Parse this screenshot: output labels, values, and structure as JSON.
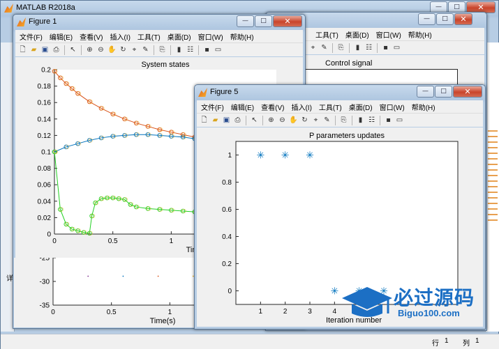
{
  "matlab": {
    "title": "MATLAB R2018a",
    "status_row_label": "行",
    "status_row_value": "1",
    "status_col_label": "列",
    "status_col_value": "1",
    "side_text": "详"
  },
  "menus": [
    "文件(F)",
    "编辑(E)",
    "查看(V)",
    "插入(I)",
    "工具(T)",
    "桌面(D)",
    "窗口(W)",
    "帮助(H)"
  ],
  "figure_back": {
    "menus_visible": [
      "工具(T)",
      "桌面(D)",
      "窗口(W)",
      "帮助(H)"
    ],
    "plot_title": "Control signal"
  },
  "figure1": {
    "title": "Figure 1",
    "lower_xlabel": "Time(s)"
  },
  "figure5": {
    "title": "Figure 5"
  },
  "watermark": {
    "brand": "必过源码",
    "url": "Biguo100.com"
  },
  "colors": {
    "title_bar": "#c7d9ec",
    "figure_bg": "#f0f0f0",
    "blue": "#0072BD",
    "orange": "#D95319",
    "yellow": "#EDB120",
    "green": "#22d022",
    "watermark_blue": "#1c6fc4"
  },
  "icons": [
    "new-file-icon",
    "open-icon",
    "save-icon",
    "print-icon",
    "pointer-icon",
    "zoom-in-icon",
    "zoom-out-icon",
    "pan-icon",
    "rotate-icon",
    "data-cursor-icon",
    "brush-icon",
    "link-icon",
    "colorbar-icon",
    "legend-icon",
    "grid-icon",
    "property-icon"
  ],
  "chart_data": [
    {
      "id": "system-states",
      "type": "line",
      "title": "System states",
      "xlabel": "Time(s)",
      "ylabel": "",
      "xlim": [
        0,
        1.9
      ],
      "ylim": [
        0,
        0.2
      ],
      "xticks": [
        "0",
        "0.5",
        "1",
        "1.5"
      ],
      "yticks": [
        "0",
        "0.02",
        "0.04",
        "0.06",
        "0.08",
        "0.1",
        "0.12",
        "0.14",
        "0.16",
        "0.18",
        "0.2"
      ],
      "series": [
        {
          "color": "#D95319",
          "x": [
            0,
            0.05,
            0.1,
            0.15,
            0.2,
            0.3,
            0.4,
            0.5,
            0.6,
            0.7,
            0.8,
            0.9,
            1.0,
            1.1,
            1.2,
            1.3,
            1.4,
            1.5,
            1.6,
            1.7,
            1.8,
            1.9
          ],
          "y": [
            0.198,
            0.19,
            0.183,
            0.177,
            0.171,
            0.161,
            0.153,
            0.146,
            0.14,
            0.135,
            0.131,
            0.127,
            0.124,
            0.121,
            0.118,
            0.115,
            0.112,
            0.109,
            0.107,
            0.105,
            0.103,
            0.1
          ]
        },
        {
          "color": "#0072BD",
          "x": [
            0,
            0.1,
            0.2,
            0.3,
            0.4,
            0.5,
            0.6,
            0.7,
            0.8,
            0.9,
            1.0,
            1.1,
            1.2,
            1.3,
            1.4,
            1.5,
            1.6,
            1.7,
            1.8,
            1.9
          ],
          "y": [
            0.1,
            0.106,
            0.11,
            0.114,
            0.117,
            0.119,
            0.12,
            0.121,
            0.121,
            0.12,
            0.119,
            0.118,
            0.116,
            0.114,
            0.112,
            0.11,
            0.107,
            0.105,
            0.103,
            0.101
          ]
        },
        {
          "color": "#22d022",
          "x": [
            0,
            0.05,
            0.1,
            0.15,
            0.2,
            0.25,
            0.3,
            0.32,
            0.35,
            0.4,
            0.45,
            0.5,
            0.55,
            0.6,
            0.65,
            0.7,
            0.8,
            0.9,
            1.0,
            1.1,
            1.2,
            1.3,
            1.4,
            1.5,
            1.6,
            1.7,
            1.8,
            1.9
          ],
          "y": [
            0.1,
            0.03,
            0.012,
            0.006,
            0.004,
            0.002,
            0.001,
            0.022,
            0.038,
            0.043,
            0.044,
            0.044,
            0.043,
            0.042,
            0.036,
            0.033,
            0.031,
            0.03,
            0.029,
            0.028,
            0.027,
            0.026,
            0.025,
            0.024,
            0.024,
            0.023,
            0.023,
            0.022
          ]
        }
      ]
    },
    {
      "id": "p-parameters-updates",
      "type": "scatter",
      "title": "P parameters updates",
      "xlabel": "Iteration number",
      "ylabel": "",
      "xlim": [
        0,
        9
      ],
      "ylim": [
        -0.1,
        1.1
      ],
      "xticks": [
        "1",
        "2",
        "3",
        "4",
        "5"
      ],
      "yticks": [
        "0",
        "0.2",
        "0.4",
        "0.6",
        "0.8",
        "1"
      ],
      "series": [
        {
          "color": "#0072BD",
          "marker": "asterisk",
          "x": [
            1,
            2,
            3,
            4,
            5,
            6
          ],
          "y": [
            1,
            1,
            1,
            0,
            0,
            0
          ]
        }
      ]
    },
    {
      "id": "lower-axes-figure1",
      "type": "scatter",
      "title": "",
      "xlabel": "Time(s)",
      "ylabel": "",
      "xticks": [
        "0",
        "0.5",
        "1",
        "1.5"
      ],
      "yticks": [
        "-25",
        "-30",
        "-35"
      ],
      "ylim": [
        -35,
        -25
      ]
    }
  ]
}
